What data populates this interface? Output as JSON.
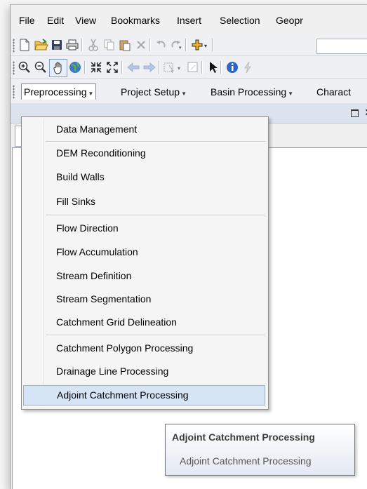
{
  "menubar": {
    "items": [
      "File",
      "Edit",
      "View",
      "Bookmarks",
      "Insert",
      "Selection",
      "Geopr"
    ]
  },
  "toolbar_icons": {
    "standard": [
      "new-document-icon",
      "open-folder-icon",
      "save-icon",
      "print-icon",
      "cut-icon",
      "copy-icon",
      "paste-icon",
      "delete-icon",
      "undo-icon",
      "redo-icon",
      "add-data-icon"
    ],
    "tools": [
      "zoom-in-icon",
      "zoom-out-icon",
      "pan-hand-icon",
      "full-extent-globe-icon",
      "fixed-zoom-in-icon",
      "fixed-zoom-out-icon",
      "back-arrow-icon",
      "forward-arrow-icon",
      "select-features-icon",
      "clear-selection-icon",
      "select-elements-icon",
      "identify-icon",
      "hyperlink-icon"
    ]
  },
  "toolbar3": {
    "menus": [
      "Preprocessing",
      "Project Setup",
      "Basin Processing",
      "Charact"
    ]
  },
  "dropdown": {
    "items": [
      "Data Management",
      "DEM Reconditioning",
      "Build Walls",
      "Fill Sinks",
      "Flow Direction",
      "Flow Accumulation",
      "Stream Definition",
      "Stream Segmentation",
      "Catchment Grid Delineation",
      "Catchment Polygon Processing",
      "Drainage Line Processing",
      "Adjoint Catchment Processing"
    ],
    "highlighted_index": 11
  },
  "tooltip": {
    "title": "Adjoint Catchment Processing",
    "description": "Adjoint Catchment Processing"
  },
  "colors": {
    "highlight_bg": "#d5e5f6",
    "highlight_border": "#8db2e3",
    "panel_header": "#dbe3ee"
  }
}
